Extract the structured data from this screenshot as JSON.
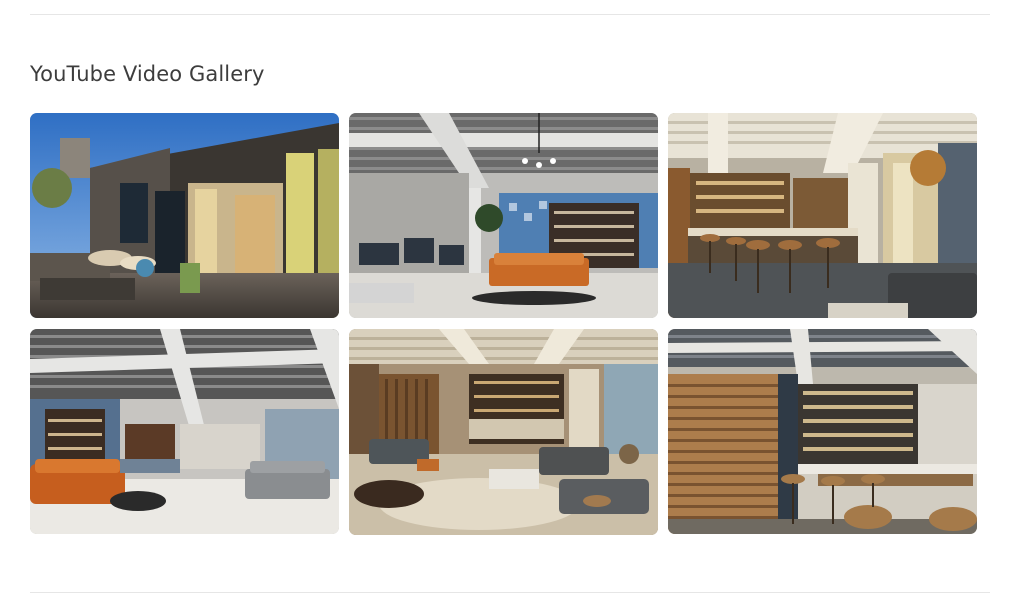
{
  "gallery": {
    "title": "YouTube Video Gallery",
    "items": [
      {
        "thumbnail": "rooftop-terrace-thumbnail"
      },
      {
        "thumbnail": "coworking-lounge-thumbnail"
      },
      {
        "thumbnail": "bar-counter-thumbnail"
      },
      {
        "thumbnail": "open-lounge-thumbnail"
      },
      {
        "thumbnail": "lobby-bar-thumbnail"
      },
      {
        "thumbnail": "cocktail-bar-thumbnail"
      }
    ]
  }
}
